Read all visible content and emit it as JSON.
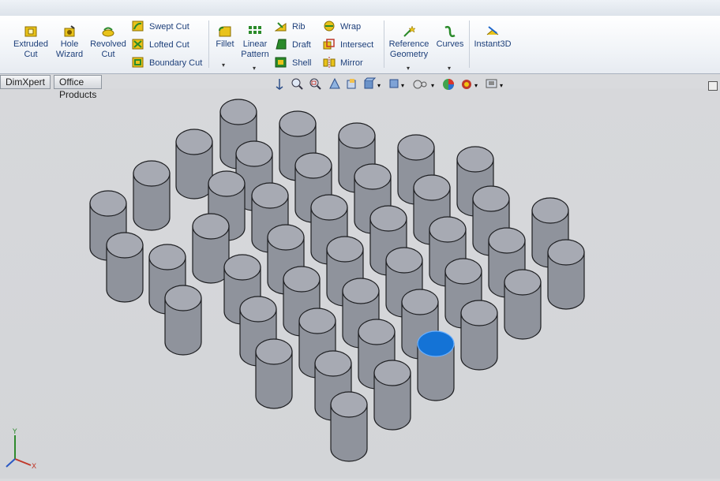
{
  "ribbon": {
    "extruded_cut": [
      "Extruded",
      "Cut"
    ],
    "hole_wizard": [
      "Hole",
      "Wizard"
    ],
    "revolved_cut": [
      "Revolved",
      "Cut"
    ],
    "swept_cut": "Swept Cut",
    "lofted_cut": "Lofted Cut",
    "boundary_cut": "Boundary Cut",
    "fillet": "Fillet",
    "linear_pattern": [
      "Linear",
      "Pattern"
    ],
    "rib": "Rib",
    "draft": "Draft",
    "shell": "Shell",
    "wrap": "Wrap",
    "intersect": "Intersect",
    "mirror": "Mirror",
    "reference_geometry": [
      "Reference",
      "Geometry"
    ],
    "curves": "Curves",
    "instant3d": "Instant3D"
  },
  "tabs": [
    "DimXpert",
    "Office Products"
  ],
  "colors": {
    "cylinder_fill": "#8f939c",
    "cylinder_top": "#a7aab3",
    "selected_face": "#1473d6",
    "background": "#d6d7da"
  },
  "heads_up_icons": [
    "previous-view-icon",
    "zoom-to-fit-icon",
    "zoom-area-icon",
    "section-view-icon",
    "view-orientation-icon",
    "display-style-icon",
    "hide-show-icon",
    "edit-appearance-icon",
    "apply-scene-icon",
    "view-settings-icon"
  ],
  "triad_axes": [
    "Y",
    "X"
  ]
}
